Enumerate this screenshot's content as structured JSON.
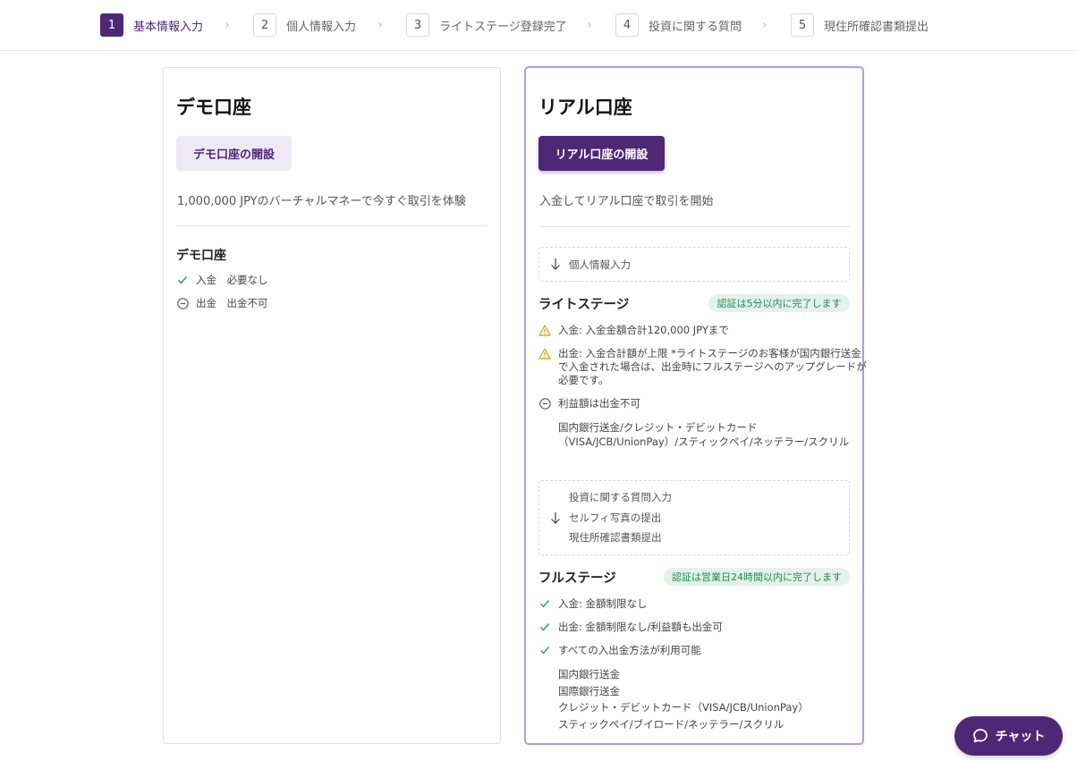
{
  "stepper": {
    "steps": [
      {
        "num": "1",
        "label": "基本情報入力"
      },
      {
        "num": "2",
        "label": "個人情報入力"
      },
      {
        "num": "3",
        "label": "ライトステージ登録完了"
      },
      {
        "num": "4",
        "label": "投資に関する質問"
      },
      {
        "num": "5",
        "label": "現住所確認書類提出"
      }
    ]
  },
  "demo": {
    "title": "デモ口座",
    "button": "デモ口座の開設",
    "description": "1,000,000 JPYのバーチャルマネーで今すぐ取引を体験",
    "section_title": "デモ口座",
    "deposit": "入金　必要なし",
    "withdraw": "出金　出金不可"
  },
  "real": {
    "title": "リアル口座",
    "button": "リアル口座の開設",
    "description": "入金してリアル口座で取引を開始",
    "step_personal": "個人情報入力",
    "lite": {
      "title": "ライトステージ",
      "badge": "認証は5分以内に完了します",
      "deposit": "入金: 入金金額合計120,000 JPYまで",
      "withdraw_line1": "出金: 入金合計額が上限 *ライトステージのお客様が国内銀行送金",
      "withdraw_line2": "で入金された場合は、出金時にフルステージへのアップグレードが",
      "withdraw_line3": "必要です。",
      "profit": "利益額は出金不可",
      "methods_line1": "国内銀行送金/クレジット・デビットカード",
      "methods_line2": "（VISA/JCB/UnionPay）/スティックペイ/ネッテラー/スクリル"
    },
    "verify_steps": {
      "line1": "投資に関する質問入力",
      "line2": "セルフィ写真の提出",
      "line3": "現住所確認書類提出"
    },
    "full": {
      "title": "フルステージ",
      "badge": "認証は営業日24時間以内に完了します",
      "deposit": "入金: 金額制限なし",
      "withdraw": "出金: 金額制限なし/利益額も出金可",
      "all_methods": "すべての入出金方法が利用可能",
      "method1": "国内銀行送金",
      "method2": "国際銀行送金",
      "method3": "クレジット・デビットカード（VISA/JCB/UnionPay）",
      "method4": "スティックペイ/ブイロード/ネッテラー/スクリル"
    }
  },
  "chat": {
    "label": "チャット"
  },
  "colors": {
    "brand": "#4f2777",
    "success": "#1f8a52",
    "warning": "#e0a000"
  }
}
